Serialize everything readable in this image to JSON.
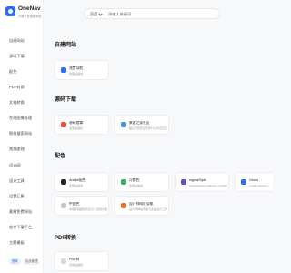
{
  "brand": {
    "title": "OneNav",
    "subtitle": "开源书签管理系统",
    "color": "#2a6df4"
  },
  "search": {
    "engine": "百度",
    "placeholder": "请输入关键词"
  },
  "sidebar": {
    "items": [
      {
        "label": "自建网站"
      },
      {
        "label": "源码下载"
      },
      {
        "label": "配色"
      },
      {
        "label": "PDF转换"
      },
      {
        "label": "文档转换"
      },
      {
        "label": "在线图像处理"
      },
      {
        "label": "图像搜索网站"
      },
      {
        "label": "视频處理"
      },
      {
        "label": "设计网"
      },
      {
        "label": "设计工具"
      },
      {
        "label": "设置汇集"
      },
      {
        "label": "素材免费网站"
      },
      {
        "label": "软件下载平台"
      },
      {
        "label": "主题模板"
      }
    ],
    "footer": {
      "login": "登录",
      "admin": "后台管理"
    }
  },
  "sections": [
    {
      "title": "自建网站",
      "cards": [
        {
          "name": "流梦导航",
          "desc": "这里是描述",
          "icon_color": "#2a6df4"
        }
      ]
    },
    {
      "title": "源码下载",
      "cards": [
        {
          "name": "源码猎掌",
          "desc": "这里是描述",
          "icon_color": "#e94b3c"
        },
        {
          "name": "果客之家社区",
          "desc": "做正已经安全靠你行之外自己打工社",
          "icon_color": "#4a90d9"
        }
      ]
    },
    {
      "title": "配色",
      "cards": [
        {
          "name": "Adobe配色",
          "desc": "这里是描述",
          "icon_color": "#222222"
        },
        {
          "name": "可颜色",
          "desc": "这里是描述",
          "icon_color": "#3aa76d"
        },
        {
          "name": "sigmaStyle",
          "desc": "A handpicked collection of 1000…",
          "icon_color": "#6c4cbf"
        },
        {
          "name": "Gross",
          "desc": "Create effective…",
          "icon_color": "#2a6df4"
        },
        {
          "name": "中国色",
          "desc": "中国传统颜色值表示，感受中国…",
          "icon_color": "#c6c6c6"
        },
        {
          "name": "设计师网址导航",
          "desc": "设计师网站导航大全是设计工作…",
          "icon_color": "#e26d2d"
        }
      ]
    },
    {
      "title": "PDF转换",
      "cards": [
        {
          "name": "PDF转",
          "desc": "这里是描述",
          "icon_color": "#d8d8d8"
        }
      ]
    }
  ]
}
